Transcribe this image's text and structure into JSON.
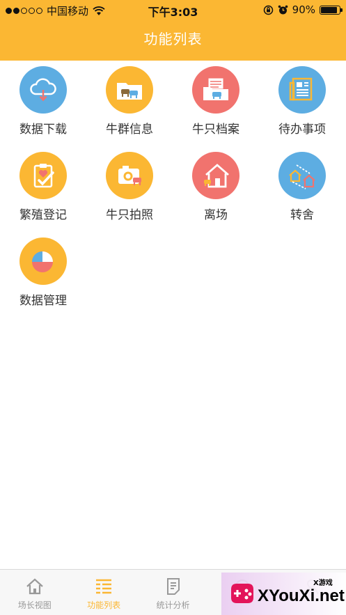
{
  "status_bar": {
    "carrier": "中国移动",
    "time": "下午3:03",
    "battery": "90%",
    "battery_level": 0.9,
    "signal_bars": 2
  },
  "nav": {
    "title": "功能列表"
  },
  "colors": {
    "brand": "#fbb733",
    "blue": "#5dade2",
    "red": "#f1736e",
    "tab_inactive": "#999999"
  },
  "functions": [
    {
      "label": "数据下载",
      "icon": "cloud-download-icon",
      "color": "#5dade2"
    },
    {
      "label": "牛群信息",
      "icon": "herd-folder-icon",
      "color": "#fbb733"
    },
    {
      "label": "牛只档案",
      "icon": "cattle-archive-icon",
      "color": "#f1736e"
    },
    {
      "label": "待办事项",
      "icon": "newspaper-icon",
      "color": "#5dade2"
    },
    {
      "label": "繁殖登记",
      "icon": "clipboard-heart-icon",
      "color": "#fbb733"
    },
    {
      "label": "牛只拍照",
      "icon": "camera-icon",
      "color": "#fbb733"
    },
    {
      "label": "离场",
      "icon": "house-exit-icon",
      "color": "#f1736e"
    },
    {
      "label": "转舍",
      "icon": "transfer-barn-icon",
      "color": "#5dade2"
    },
    {
      "label": "数据管理",
      "icon": "pie-chart-icon",
      "color": "#fbb733"
    }
  ],
  "tabs": [
    {
      "label": "场长视图",
      "icon": "home-icon",
      "active": false
    },
    {
      "label": "功能列表",
      "icon": "list-icon",
      "active": true
    },
    {
      "label": "统计分析",
      "icon": "document-icon",
      "active": false
    },
    {
      "label": "",
      "icon": "tab-icon-4",
      "active": false
    },
    {
      "label": "",
      "icon": "tab-icon-5",
      "active": false
    }
  ],
  "watermark": {
    "small": "X游戏",
    "big": "XYouXi.net"
  }
}
